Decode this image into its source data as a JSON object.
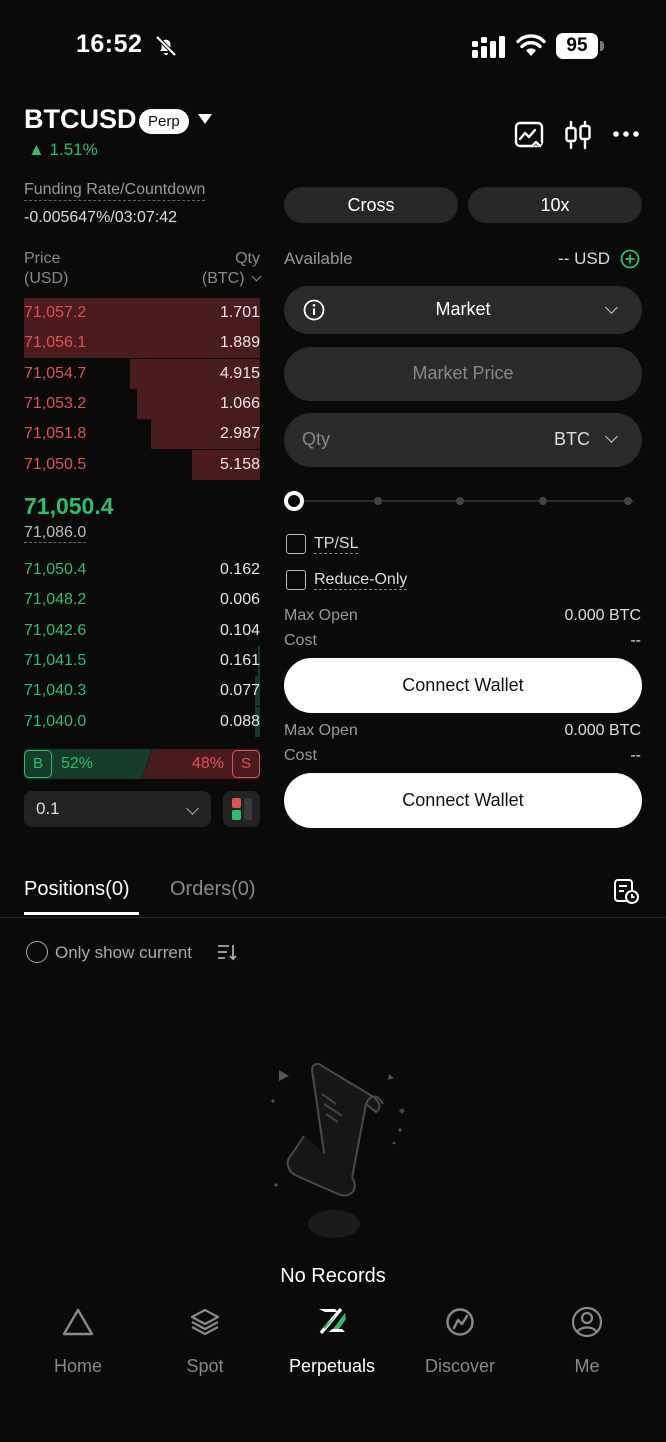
{
  "status_bar": {
    "time": "16:52",
    "battery": "95"
  },
  "header": {
    "pair": "BTCUSD",
    "badge": "Perp",
    "change": "▲ 1.51%"
  },
  "funding": {
    "label": "Funding Rate/Countdown",
    "value": "-0.005647%/03:07:42"
  },
  "margin": {
    "mode": "Cross",
    "leverage": "10x"
  },
  "order_book": {
    "price_header": [
      "Price",
      "(USD)"
    ],
    "qty_header": [
      "Qty",
      "(BTC)"
    ],
    "asks": [
      {
        "price": "71,057.2",
        "qty": "1.701",
        "depth": 1.0
      },
      {
        "price": "71,056.1",
        "qty": "1.889",
        "depth": 1.0
      },
      {
        "price": "71,054.7",
        "qty": "4.915",
        "depth": 0.55
      },
      {
        "price": "71,053.2",
        "qty": "1.066",
        "depth": 0.52
      },
      {
        "price": "71,051.8",
        "qty": "2.987",
        "depth": 0.46
      },
      {
        "price": "71,050.5",
        "qty": "5.158",
        "depth": 0.29
      }
    ],
    "last_price": "71,050.4",
    "mark_price": "71,086.0",
    "bids": [
      {
        "price": "71,050.4",
        "qty": "0.162",
        "depth": 0.0
      },
      {
        "price": "71,048.2",
        "qty": "0.006",
        "depth": 0.0
      },
      {
        "price": "71,042.6",
        "qty": "0.104",
        "depth": 0.0
      },
      {
        "price": "71,041.5",
        "qty": "0.161",
        "depth": 0.01
      },
      {
        "price": "71,040.3",
        "qty": "0.077",
        "depth": 0.02
      },
      {
        "price": "71,040.0",
        "qty": "0.088",
        "depth": 0.02
      }
    ],
    "buy_ratio": {
      "tag": "B",
      "pct": "52%"
    },
    "sell_ratio": {
      "tag": "S",
      "pct": "48%"
    },
    "depth_step": "0.1"
  },
  "order_form": {
    "available_label": "Available",
    "available_value": "-- USD",
    "order_type": "Market",
    "market_price": "Market Price",
    "qty_placeholder": "Qty",
    "qty_unit": "BTC",
    "tpsl": "TP/SL",
    "reduce_only": "Reduce-Only",
    "buy": {
      "max_open_label": "Max Open",
      "max_open_value": "0.000 BTC",
      "cost_label": "Cost",
      "cost_value": "--",
      "button": "Connect Wallet"
    },
    "sell": {
      "max_open_label": "Max Open",
      "max_open_value": "0.000 BTC",
      "cost_label": "Cost",
      "cost_value": "--",
      "button": "Connect Wallet"
    }
  },
  "tabs": {
    "positions": "Positions(0)",
    "orders": "Orders(0)"
  },
  "filter": {
    "label": "Only show current"
  },
  "empty_state": {
    "text": "No Records"
  },
  "nav": {
    "home": "Home",
    "spot": "Spot",
    "perpetuals": "Perpetuals",
    "discover": "Discover",
    "me": "Me"
  },
  "colors": {
    "up": "#2bbf6b",
    "down": "#e05353",
    "background": "#0a0a0a"
  }
}
